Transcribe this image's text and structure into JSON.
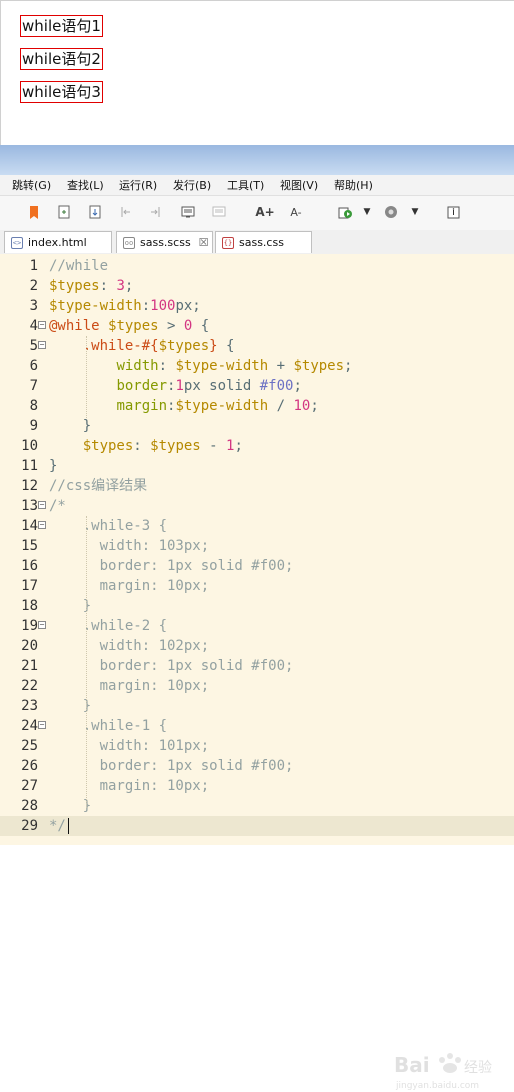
{
  "preview": {
    "items": [
      "while语句1",
      "while语句2",
      "while语句3"
    ]
  },
  "menubar": {
    "items": [
      "跳转(G)",
      "查找(L)",
      "运行(R)",
      "发行(B)",
      "工具(T)",
      "视图(V)",
      "帮助(H)"
    ]
  },
  "toolbar": {
    "icons": [
      "bookmark-icon",
      "new-file-icon",
      "save-icon",
      "step-back-icon",
      "step-forward-icon",
      "preview-icon",
      "preview-disabled-icon",
      "font-increase-icon",
      "font-decrease-icon",
      "run-icon",
      "dropdown-icon",
      "browser-icon",
      "dropdown-icon",
      "info-icon"
    ],
    "font_increase": "A+",
    "font_decrease": "A-"
  },
  "tabs": [
    {
      "label": "index.html",
      "icon": "html-file-icon"
    },
    {
      "label": "sass.scss",
      "icon": "scss-file-icon",
      "close": "☒"
    },
    {
      "label": "sass.css",
      "icon": "css-file-icon"
    }
  ],
  "editor": {
    "current_line": 29,
    "lines": [
      "//while",
      "$types: 3;",
      "$type-width:100px;",
      "@while $types > 0 {",
      "    .while-#{$types} {",
      "        width: $type-width + $types;",
      "        border:1px solid #f00;",
      "        margin:$type-width / 10;",
      "    }",
      "    $types: $types - 1;",
      "}",
      "//css编译结果",
      "/*",
      "    .while-3 {",
      "      width: 103px;",
      "      border: 1px solid #f00;",
      "      margin: 10px;",
      "    }",
      "    .while-2 {",
      "      width: 102px;",
      "      border: 1px solid #f00;",
      "      margin: 10px;",
      "    }",
      "    .while-1 {",
      "      width: 101px;",
      "      border: 1px solid #f00;",
      "      margin: 10px;",
      "    }",
      "*/"
    ],
    "fold_lines": [
      4,
      5,
      13,
      14,
      19,
      24
    ]
  },
  "watermark": {
    "brand": "Bai",
    "brand2": "经验",
    "url": "jingyan.baidu.com"
  },
  "colors": {
    "editor_bg": "#fdf6e3",
    "preview_border": "#e00000",
    "title_gradient_top": "#9ab8e0",
    "title_gradient_bottom": "#c9dcf2"
  }
}
